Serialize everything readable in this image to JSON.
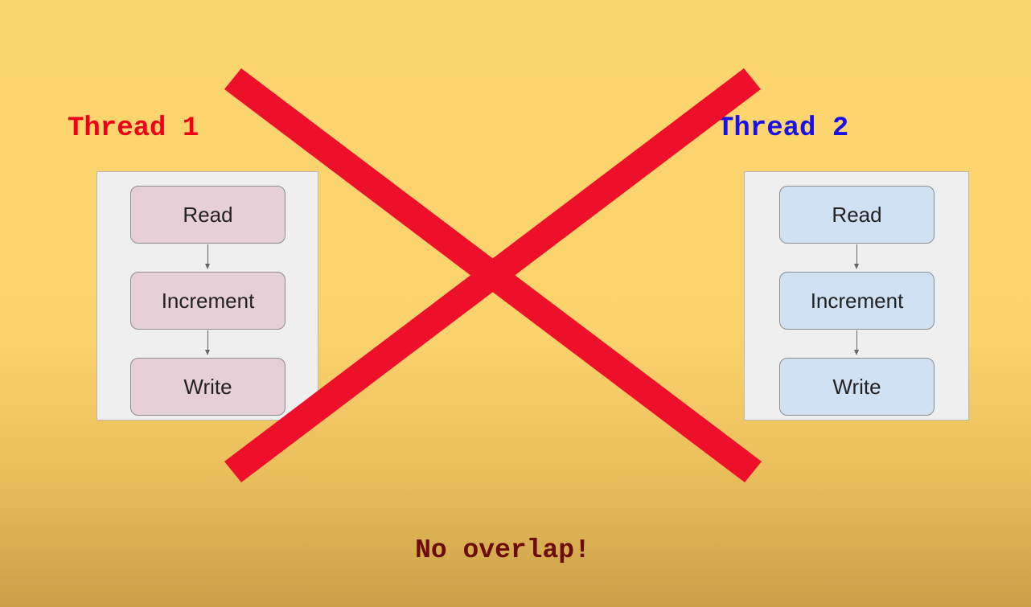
{
  "thread1": {
    "title": "Thread 1",
    "title_color": "#f2001a",
    "box_color": "#e7cfd8",
    "steps": [
      "Read",
      "Increment",
      "Write"
    ]
  },
  "thread2": {
    "title": "Thread 2",
    "title_color": "#1a10e8",
    "box_color": "#cfe1f3",
    "steps": [
      "Read",
      "Increment",
      "Write"
    ]
  },
  "cross_mark": {
    "icon": "red-x-icon",
    "color": "#ee0f2b"
  },
  "caption": "No overlap!",
  "caption_color": "#6e0b0b"
}
